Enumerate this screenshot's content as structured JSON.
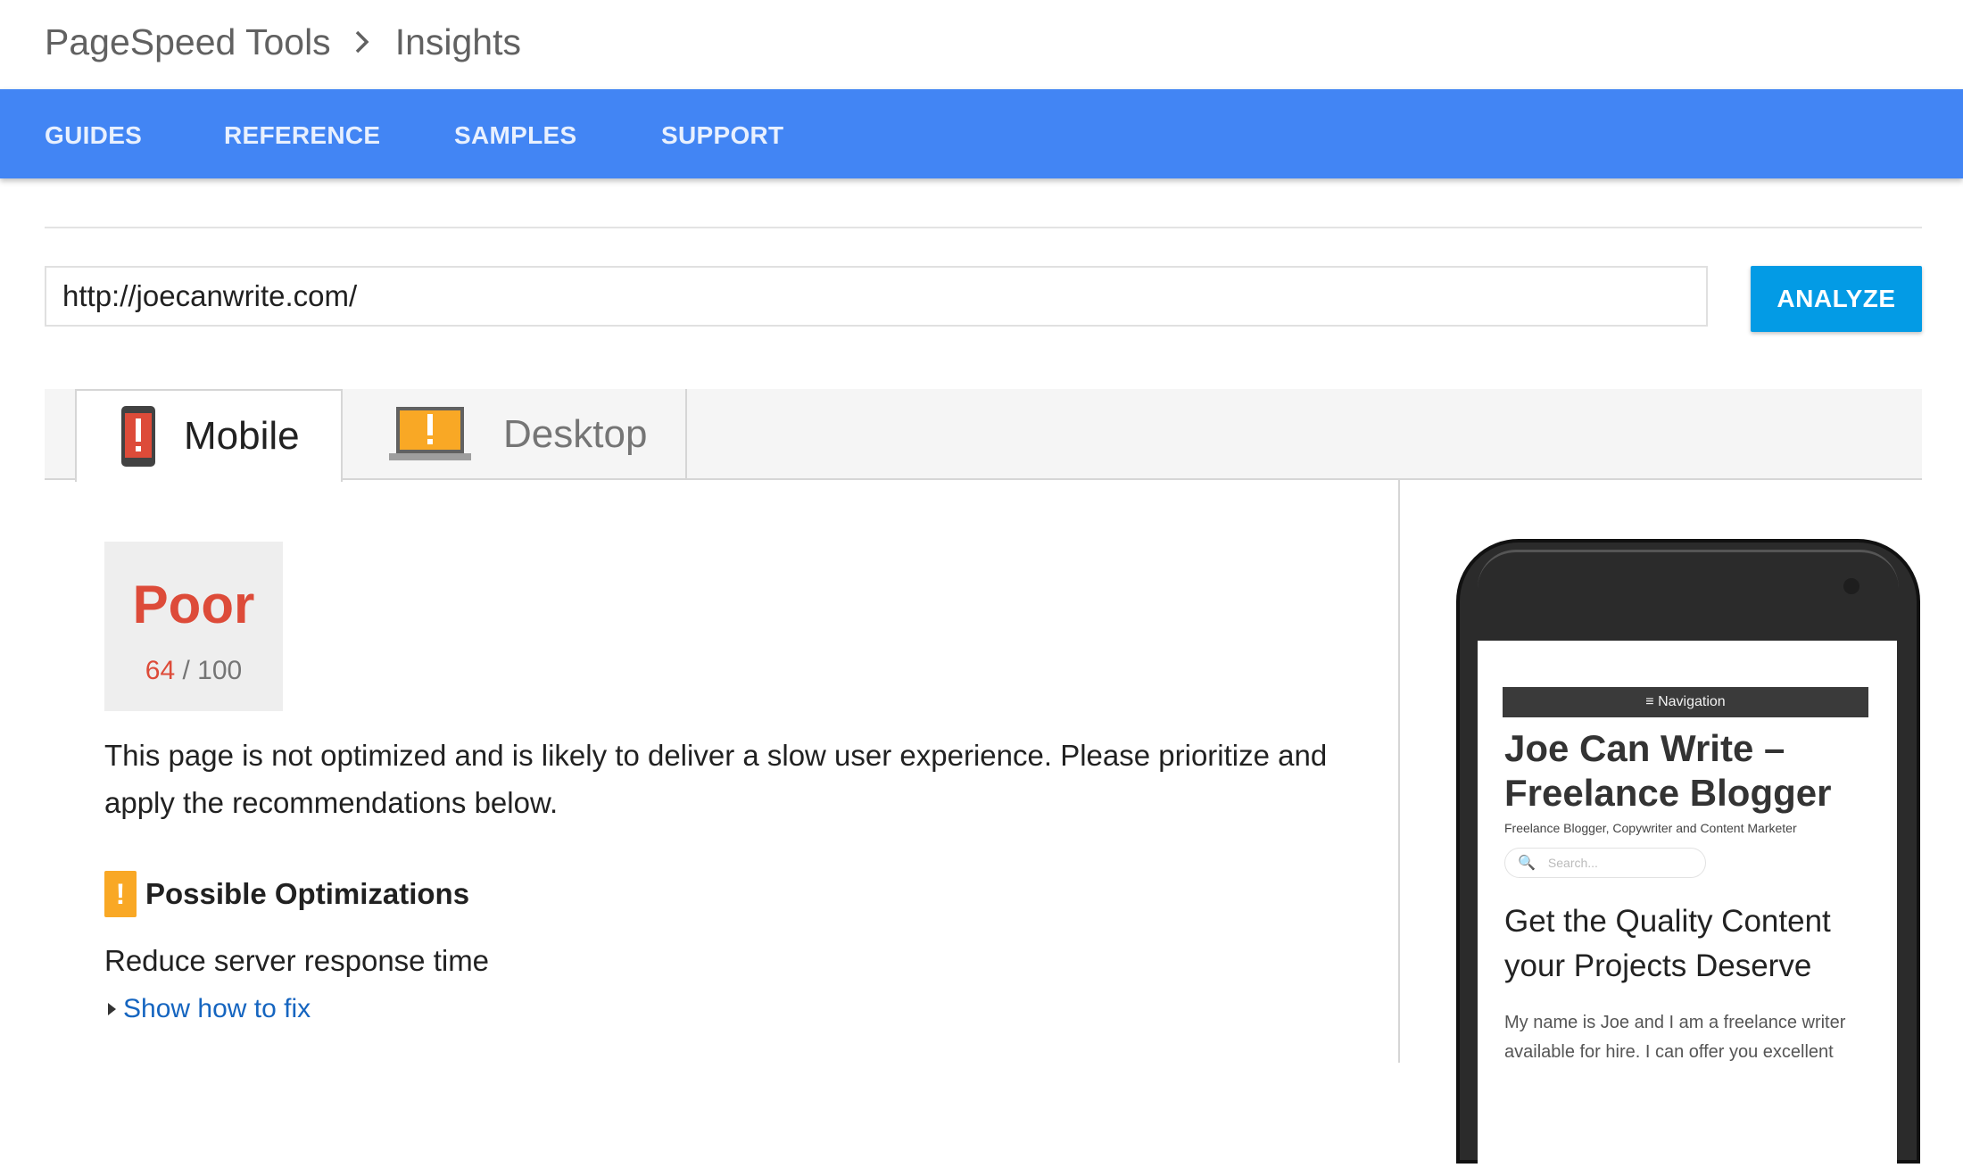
{
  "breadcrumb": {
    "parent": "PageSpeed Tools",
    "separator": "›",
    "current": "Insights"
  },
  "nav": {
    "items": [
      "GUIDES",
      "REFERENCE",
      "SAMPLES",
      "SUPPORT"
    ]
  },
  "url_input": {
    "value": "http://joecanwrite.com/"
  },
  "analyze_label": "ANALYZE",
  "tabs": [
    {
      "label": "Mobile",
      "icon": "phone-warning-icon",
      "selected": true
    },
    {
      "label": "Desktop",
      "icon": "laptop-warning-icon",
      "selected": false
    }
  ],
  "score": {
    "rating": "Poor",
    "value": "64",
    "max": "/ 100",
    "color": "#dd4b39"
  },
  "description": "This page is not optimized and is likely to deliver a slow user experience. Please prioritize and apply the recommendations below.",
  "optimizations": {
    "badge": "!",
    "title": "Possible Optimizations",
    "item": "Reduce server response time",
    "link": "Show how to fix"
  },
  "preview": {
    "nav_label": "≡ Navigation",
    "site_title": "Joe Can Write – Freelance Blogger",
    "tagline": "Freelance Blogger, Copywriter and Content Marketer",
    "search_placeholder": "Search...",
    "heading": "Get the Quality Content your Projects Deserve",
    "body": "My name is Joe and I am a freelance writer available for hire. I can offer you excellent"
  },
  "colors": {
    "nav": "#4285f4",
    "button": "#039be5",
    "warning": "#f9a825",
    "poor": "#dd4b39",
    "link": "#1565c0"
  }
}
